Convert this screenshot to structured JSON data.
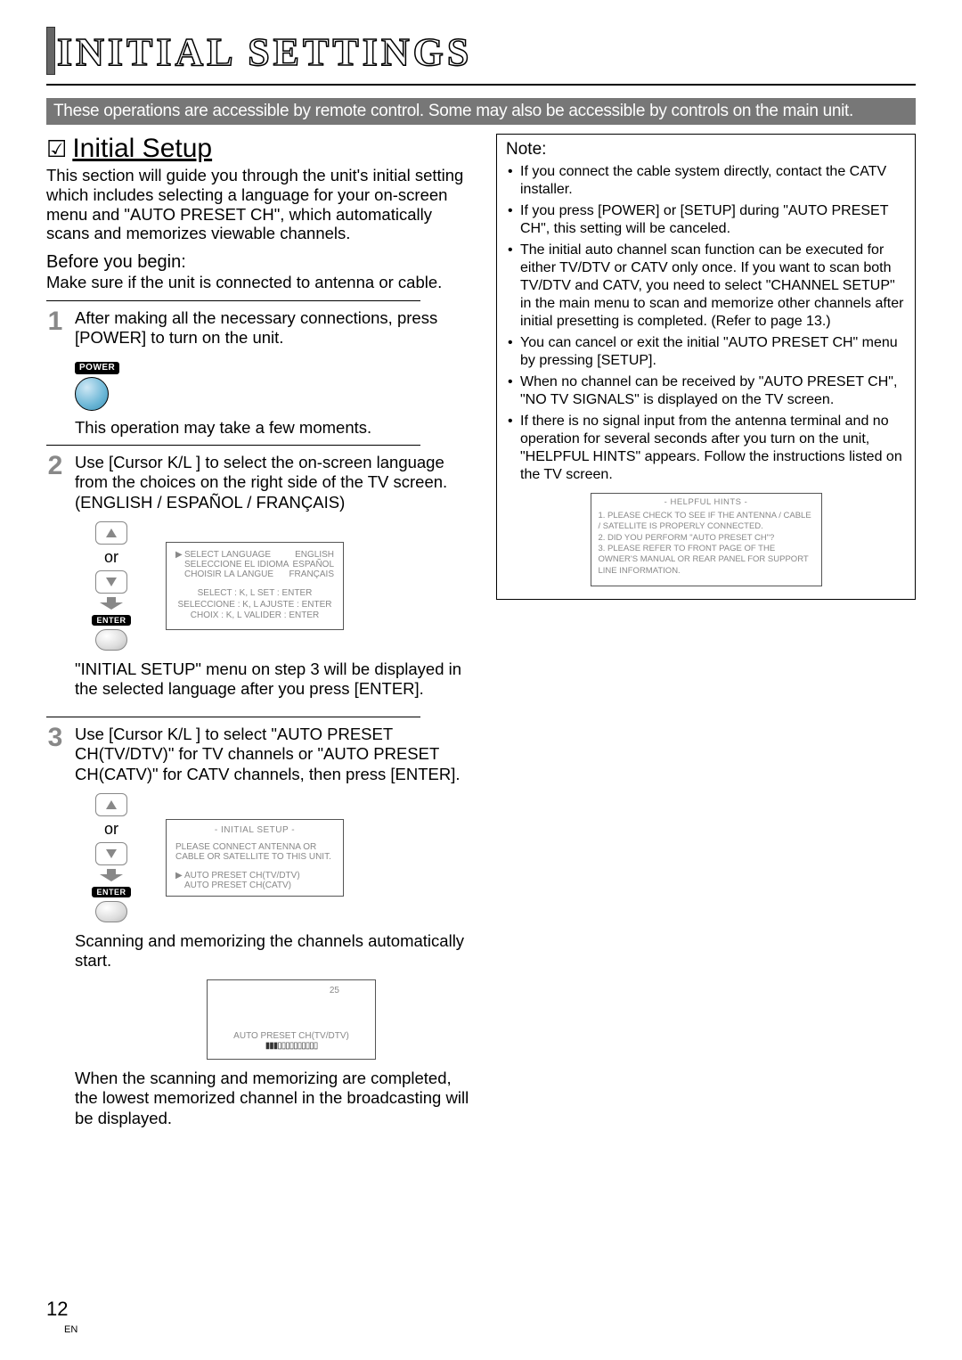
{
  "header": {
    "title": "INITIAL SETTINGS"
  },
  "grey_bar": "These operations are accessible by remote control. Some may also be accessible by controls on the main unit.",
  "initial_setup": {
    "title": "Initial Setup",
    "intro": "This section will guide you through the unit's initial setting which includes selecting a language for your on-screen menu and \"AUTO PRESET CH\", which automatically scans and memorizes viewable channels.",
    "before_label": "Before you begin:",
    "before_body": "Make sure if the unit is connected to antenna or cable.",
    "step1": {
      "num": "1",
      "text": "After making all the necessary connections, press [POWER] to turn on the unit.",
      "power_label": "POWER",
      "moment": "This operation may take a few moments."
    },
    "step2": {
      "num": "2",
      "text": "Use [Cursor K/L ] to select the on-screen language from the choices on the right side of the TV screen. (ENGLISH / ESPAÑOL / FRANÇAIS)",
      "or": "or",
      "enter_label": "ENTER",
      "osd": {
        "l1a": "SELECT LANGUAGE",
        "l1b": "ENGLISH",
        "l2a": "SELECCIONE EL IDIOMA",
        "l2b": "ESPAÑOL",
        "l3a": "CHOISIR LA LANGUE",
        "l3b": "FRANÇAIS",
        "b1": "SELECT : K, L        SET : ENTER",
        "b2": "SELECCIONE : K, L    AJUSTE : ENTER",
        "b3": "CHOIX : K, L    VALIDER : ENTER"
      },
      "after": "\"INITIAL SETUP\" menu on step 3 will be displayed in the selected language after you press [ENTER]."
    },
    "step3": {
      "num": "3",
      "text": "Use [Cursor K/L ] to select \"AUTO PRESET CH(TV/DTV)\" for TV channels or \"AUTO PRESET CH(CATV)\" for CATV channels, then press [ENTER].",
      "or": "or",
      "enter_label": "ENTER",
      "osd": {
        "title": "- INITIAL SETUP -",
        "msg": "PLEASE CONNECT ANTENNA OR CABLE OR SATELLITE TO THIS UNIT.",
        "opt1": "AUTO PRESET CH(TV/DTV)",
        "opt2": "AUTO PRESET CH(CATV)"
      },
      "scan_text": "Scanning and memorizing the channels automatically start.",
      "scan_num": "25",
      "scan_label": "AUTO PRESET CH(TV/DTV)",
      "done": "When the scanning and memorizing are completed, the lowest memorized channel in the broadcasting will be displayed."
    }
  },
  "note": {
    "title": "Note:",
    "items": [
      "If you connect the cable system directly, contact the CATV installer.",
      "If you press [POWER] or [SETUP] during \"AUTO PRESET CH\", this setting will be canceled.",
      "The initial auto channel scan function can be executed for either TV/DTV or CATV only once. If you want to scan both TV/DTV and CATV, you need to select \"CHANNEL SETUP\" in the main menu to scan and memorize other channels after initial presetting is completed. (Refer to page 13.)",
      "You can cancel or exit the initial \"AUTO PRESET CH\" menu by pressing [SETUP].",
      "When no channel can be received by \"AUTO PRESET CH\", \"NO TV SIGNALS\" is displayed on the TV screen.",
      "If there is no signal input from the antenna terminal and no operation for several seconds after you turn on the unit, \"HELPFUL HINTS\" appears. Follow the instructions listed on the TV screen."
    ],
    "hints": {
      "title": "- HELPFUL HINTS -",
      "l1": "1. PLEASE CHECK TO SEE IF THE ANTENNA / CABLE / SATELLITE IS PROPERLY CONNECTED.",
      "l2": "2. DID YOU PERFORM \"AUTO PRESET CH\"?",
      "l3": "3. PLEASE REFER TO FRONT PAGE OF THE OWNER'S MANUAL OR REAR PANEL FOR SUPPORT LINE INFORMATION."
    }
  },
  "page": {
    "num": "12",
    "en": "EN"
  }
}
